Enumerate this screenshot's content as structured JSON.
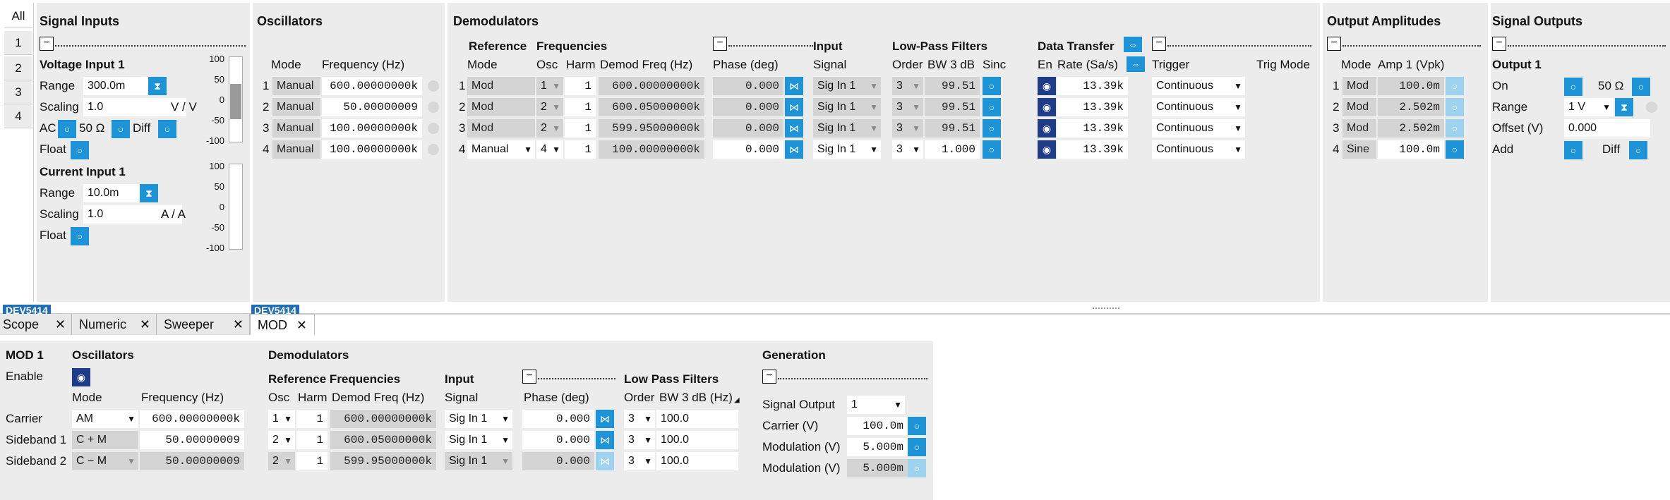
{
  "sidebar": [
    "All",
    "1",
    "2",
    "3",
    "4"
  ],
  "signal_inputs": {
    "title": "Signal Inputs",
    "voltage_title": "Voltage Input 1",
    "range_label": "Range",
    "range_value": "300.0m",
    "scaling_label": "Scaling",
    "scaling_value": "1.0",
    "scaling_unit": "V / V",
    "ac_label": "AC",
    "ohm_label": "50 Ω",
    "diff_label": "Diff",
    "float_label": "Float",
    "current_title": "Current Input 1",
    "cur_range_value": "10.0m",
    "cur_scaling_value": "1.0",
    "cur_unit": "A / A",
    "scale_ticks": [
      "100",
      "50",
      "0",
      "-50",
      "-100"
    ]
  },
  "oscillators": {
    "title": "Oscillators",
    "col_mode": "Mode",
    "col_freq": "Frequency (Hz)",
    "rows": [
      {
        "n": "1",
        "mode": "Manual",
        "freq": "600.00000000k"
      },
      {
        "n": "2",
        "mode": "Manual",
        "freq": "50.00000009"
      },
      {
        "n": "3",
        "mode": "Manual",
        "freq": "100.00000000k"
      },
      {
        "n": "4",
        "mode": "Manual",
        "freq": "100.00000000k"
      }
    ]
  },
  "demodulators": {
    "title": "Demodulators",
    "h_reference": "Reference",
    "h_frequencies": "Frequencies",
    "h_input": "Input",
    "h_lpf": "Low-Pass Filters",
    "h_transfer": "Data Transfer",
    "c_mode": "Mode",
    "c_osc": "Osc",
    "c_harm": "Harm",
    "c_freq": "Demod Freq (Hz)",
    "c_phase": "Phase (deg)",
    "c_signal": "Signal",
    "c_order": "Order",
    "c_bw": "BW 3 dB",
    "c_sinc": "Sinc",
    "c_en": "En",
    "c_rate": "Rate (Sa/s)",
    "c_trigger": "Trigger",
    "c_trigmode": "Trig Mode",
    "rows": [
      {
        "n": "1",
        "mode": "Mod",
        "osc": "1",
        "harm": "1",
        "freq": "600.00000000k",
        "phase": "0.000",
        "signal": "Sig In 1",
        "order": "3",
        "bw": "99.51",
        "rate": "13.39k",
        "trigger": "Continuous"
      },
      {
        "n": "2",
        "mode": "Mod",
        "osc": "2",
        "harm": "1",
        "freq": "600.05000000k",
        "phase": "0.000",
        "signal": "Sig In 1",
        "order": "3",
        "bw": "99.51",
        "rate": "13.39k",
        "trigger": "Continuous"
      },
      {
        "n": "3",
        "mode": "Mod",
        "osc": "2",
        "harm": "1",
        "freq": "599.95000000k",
        "phase": "0.000",
        "signal": "Sig In 1",
        "order": "3",
        "bw": "99.51",
        "rate": "13.39k",
        "trigger": "Continuous"
      },
      {
        "n": "4",
        "mode": "Manual",
        "osc": "4",
        "harm": "1",
        "freq": "100.00000000k",
        "phase": "0.000",
        "signal": "Sig In 1",
        "order": "3",
        "bw": "1.000",
        "rate": "13.39k",
        "trigger": "Continuous"
      }
    ]
  },
  "output_amplitudes": {
    "title": "Output Amplitudes",
    "c_mode": "Mode",
    "c_amp": "Amp 1 (Vpk)",
    "rows": [
      {
        "n": "1",
        "mode": "Mod",
        "amp": "100.0m"
      },
      {
        "n": "2",
        "mode": "Mod",
        "amp": "2.502m"
      },
      {
        "n": "3",
        "mode": "Mod",
        "amp": "2.502m"
      },
      {
        "n": "4",
        "mode": "Sine",
        "amp": "100.0m"
      }
    ]
  },
  "signal_outputs": {
    "title": "Signal Outputs",
    "output_title": "Output 1",
    "on_label": "On",
    "ohm_label": "50 Ω",
    "range_label": "Range",
    "range_value": "1 V",
    "offset_label": "Offset (V)",
    "offset_value": "0.000",
    "add_label": "Add",
    "diff_label": "Diff"
  },
  "tabs": {
    "device": "DEV5414",
    "items": [
      "Scope",
      "Numeric",
      "Sweeper",
      "MOD"
    ]
  },
  "mod": {
    "title": "MOD 1",
    "enable_label": "Enable",
    "osc_title": "Oscillators",
    "c_mode": "Mode",
    "c_freq": "Frequency (Hz)",
    "osc_rows": [
      {
        "label": "Carrier",
        "mode": "AM",
        "freq": "600.00000000k"
      },
      {
        "label": "Sideband 1",
        "mode": "C + M",
        "freq": "50.00000009"
      },
      {
        "label": "Sideband 2",
        "mode": "C − M",
        "freq": "50.00000009"
      }
    ],
    "demod_title": "Demodulators",
    "h_ref": "Reference Frequencies",
    "h_input": "Input",
    "h_lpf": "Low Pass Filters",
    "c_osc": "Osc",
    "c_harm": "Harm",
    "c_dfreq": "Demod Freq (Hz)",
    "c_signal": "Signal",
    "c_phase": "Phase (deg)",
    "c_order": "Order",
    "c_bw": "BW 3 dB (Hz)",
    "demod_rows": [
      {
        "osc": "1",
        "harm": "1",
        "freq": "600.00000000k",
        "signal": "Sig In 1",
        "phase": "0.000",
        "order": "3",
        "bw": "100.0"
      },
      {
        "osc": "2",
        "harm": "1",
        "freq": "600.05000000k",
        "signal": "Sig In 1",
        "phase": "0.000",
        "order": "3",
        "bw": "100.0"
      },
      {
        "osc": "2",
        "harm": "1",
        "freq": "599.95000000k",
        "signal": "Sig In 1",
        "phase": "0.000",
        "order": "3",
        "bw": "100.0"
      }
    ],
    "gen_title": "Generation",
    "sig_out_label": "Signal Output",
    "sig_out_value": "1",
    "carrier_label": "Carrier (V)",
    "carrier_value": "100.0m",
    "mod1_label": "Modulation (V)",
    "mod1_value": "5.000m",
    "mod2_label": "Modulation (V)",
    "mod2_value": "5.000m"
  },
  "colors": {
    "accent": "#1d93d8",
    "tab_blue": "#1d6fb8",
    "enable_dark": "#1f3c88",
    "panel": "#ececec"
  }
}
